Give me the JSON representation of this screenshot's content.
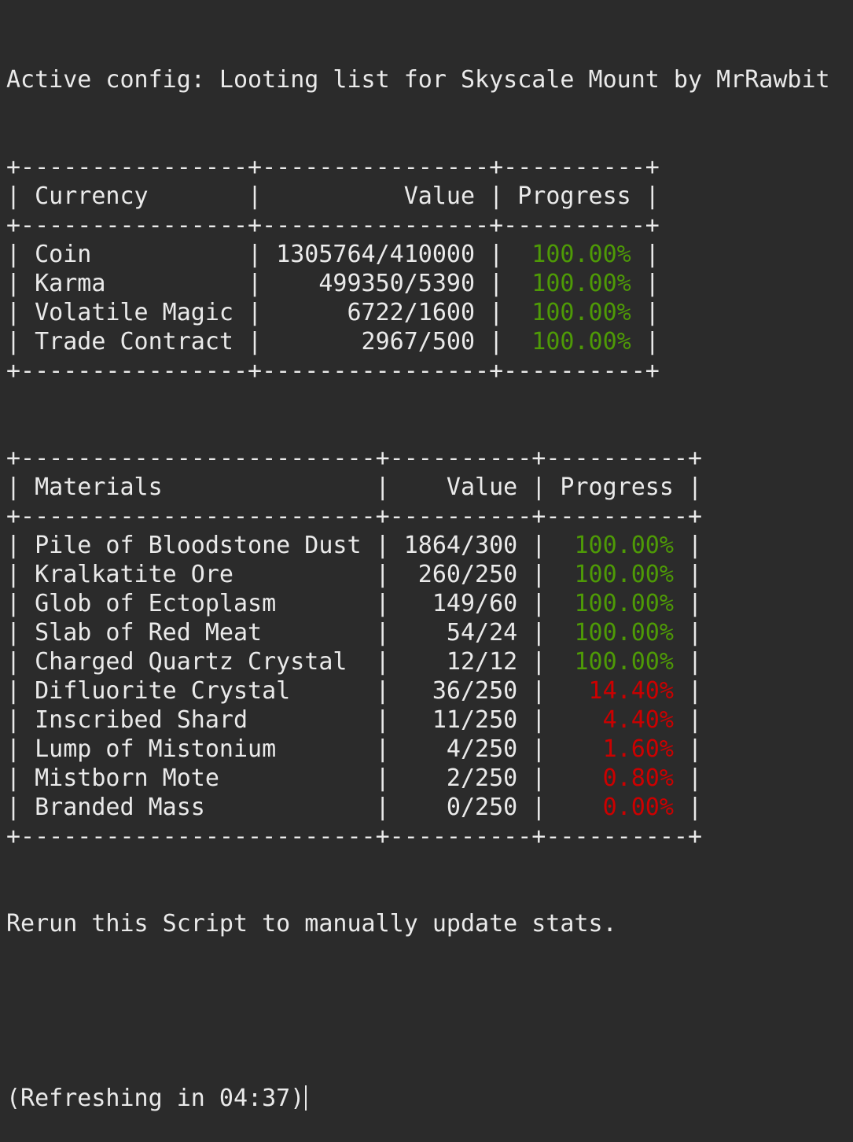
{
  "header": {
    "active_config": "Active config: Looting list for Skyscale Mount by MrRawbit"
  },
  "currency_table": {
    "headers": [
      "Currency",
      "Value",
      "Progress"
    ],
    "rows": [
      {
        "name": "Coin",
        "value": "1305764/410000",
        "progress": "100.00%",
        "status": "complete"
      },
      {
        "name": "Karma",
        "value": "499350/5390",
        "progress": "100.00%",
        "status": "complete"
      },
      {
        "name": "Volatile Magic",
        "value": "6722/1600",
        "progress": "100.00%",
        "status": "complete"
      },
      {
        "name": "Trade Contract",
        "value": "2967/500",
        "progress": "100.00%",
        "status": "complete"
      }
    ]
  },
  "materials_table": {
    "headers": [
      "Materials",
      "Value",
      "Progress"
    ],
    "rows": [
      {
        "name": "Pile of Bloodstone Dust",
        "value": "1864/300",
        "progress": "100.00%",
        "status": "complete"
      },
      {
        "name": "Kralkatite Ore",
        "value": "260/250",
        "progress": "100.00%",
        "status": "complete"
      },
      {
        "name": "Glob of Ectoplasm",
        "value": "149/60",
        "progress": "100.00%",
        "status": "complete"
      },
      {
        "name": "Slab of Red Meat",
        "value": "54/24",
        "progress": "100.00%",
        "status": "complete"
      },
      {
        "name": "Charged Quartz Crystal",
        "value": "12/12",
        "progress": "100.00%",
        "status": "complete"
      },
      {
        "name": "Difluorite Crystal",
        "value": "36/250",
        "progress": "14.40%",
        "status": "incomplete"
      },
      {
        "name": "Inscribed Shard",
        "value": "11/250",
        "progress": "4.40%",
        "status": "incomplete"
      },
      {
        "name": "Lump of Mistonium",
        "value": "4/250",
        "progress": "1.60%",
        "status": "incomplete"
      },
      {
        "name": "Mistborn Mote",
        "value": "2/250",
        "progress": "0.80%",
        "status": "incomplete"
      },
      {
        "name": "Branded Mass",
        "value": "0/250",
        "progress": "0.00%",
        "status": "incomplete"
      }
    ]
  },
  "footer": {
    "rerun_message": "Rerun this Script to manually update stats.",
    "refresh_message": "(Refreshing in 04:37)"
  },
  "colors": {
    "background": "#2b2b2b",
    "foreground": "#eaeaea",
    "complete": "#4e9a06",
    "incomplete": "#cc0000"
  }
}
